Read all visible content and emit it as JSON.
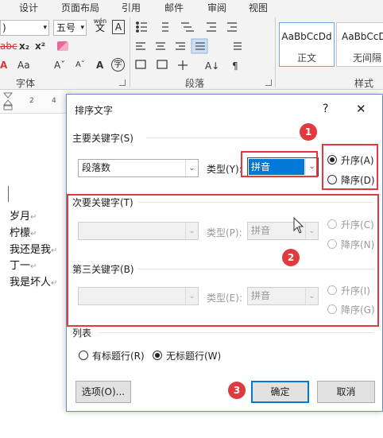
{
  "ribbon": {
    "tabs": [
      "设计",
      "页面布局",
      "引用",
      "邮件",
      "审阅",
      "视图"
    ],
    "font_size": "五号",
    "font_dropdown": ")",
    "wen_icon": "wén",
    "wen_char": "文",
    "a_box": "A",
    "group_font": "字体",
    "group_paragraph": "段落",
    "group_styles": "样式",
    "styles": [
      {
        "sample": "AaBbCcDd",
        "name": "正文"
      },
      {
        "sample": "AaBbCcDd",
        "name": "无间隔"
      }
    ],
    "fmt_row2": [
      "abc",
      "x₂",
      "x²"
    ],
    "fmt_row3": [
      "Aa",
      "Aˇ",
      "Aˇ",
      "A",
      "字"
    ],
    "ruler_numbers": [
      "2",
      "4"
    ]
  },
  "document": {
    "lines": [
      "岁月",
      "柠檬",
      "我还是我",
      "丁一",
      "我是坏人"
    ]
  },
  "dialog": {
    "title": "排序文字",
    "help": "?",
    "close": "✕",
    "primary": {
      "label": "主要关键字(S)",
      "field": "段落数",
      "type_label": "类型(Y):",
      "type_value": "拼音",
      "asc": "升序(A)",
      "desc": "降序(D)",
      "ascending_selected": true
    },
    "secondary": {
      "label": "次要关键字(T)",
      "field": "",
      "type_label": "类型(P):",
      "type_value": "拼音",
      "asc": "升序(C)",
      "desc": "降序(N)"
    },
    "tertiary": {
      "label": "第三关键字(B)",
      "field": "",
      "type_label": "类型(E):",
      "type_value": "拼音",
      "asc": "升序(I)",
      "desc": "降序(G)"
    },
    "list": {
      "label": "列表",
      "has_header": "有标题行(R)",
      "no_header": "无标题行(W)",
      "no_header_selected": true
    },
    "options_button": "选项(O)...",
    "ok_button": "确定",
    "cancel_button": "取消"
  },
  "annotations": {
    "badge1": "1",
    "badge2": "2",
    "badge3": "3",
    "color": "#e0393e"
  }
}
